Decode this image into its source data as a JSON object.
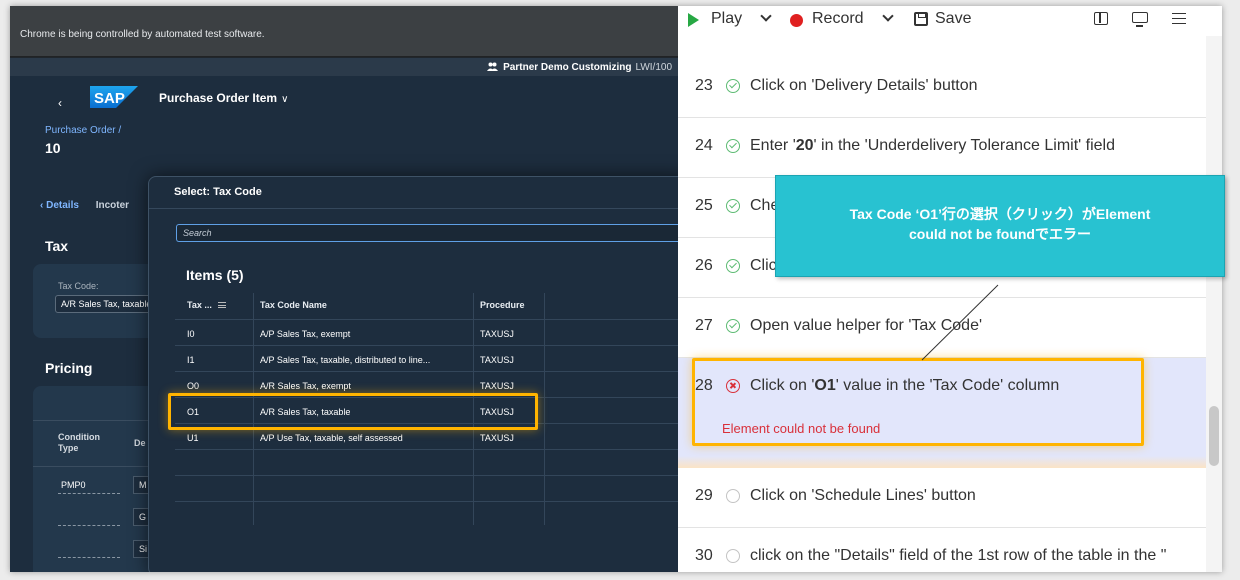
{
  "browser": {
    "automation_notice": "Chrome is being controlled by automated test software."
  },
  "sap": {
    "shellbar": {
      "customizing": "Partner Demo Customizing",
      "system": "LWI/100"
    },
    "app_title": "Purchase Order Item",
    "breadcrumb": "Purchase Order /",
    "object_number": "10",
    "tabs": {
      "details": "Details",
      "incoterms": "Incoter"
    },
    "tax_section": {
      "title": "Tax",
      "tax_code_label": "Tax Code:",
      "tax_code_value": "A/R Sales Tax, taxable"
    },
    "pricing_section": {
      "title": "Pricing",
      "col_condition_type": "Condition\nType",
      "col_desc": "De",
      "rows": [
        {
          "type": "PMP0",
          "desc": "M"
        },
        {
          "type": "",
          "desc": "G"
        },
        {
          "type": "",
          "desc": "Si"
        }
      ]
    }
  },
  "dialog": {
    "title": "Select: Tax Code",
    "search_placeholder": "Search",
    "items_title": "Items (5)",
    "columns": [
      "Tax ...",
      "Tax Code Name",
      "Procedure"
    ],
    "rows": [
      {
        "code": "I0",
        "name": "A/P Sales Tax, exempt",
        "procedure": "TAXUSJ"
      },
      {
        "code": "I1",
        "name": "A/P Sales Tax, taxable, distributed to line...",
        "procedure": "TAXUSJ"
      },
      {
        "code": "O0",
        "name": "A/R Sales Tax, exempt",
        "procedure": "TAXUSJ"
      },
      {
        "code": "O1",
        "name": "A/R Sales Tax, taxable",
        "procedure": "TAXUSJ"
      },
      {
        "code": "U1",
        "name": "A/P Use Tax, taxable, self assessed",
        "procedure": "TAXUSJ"
      }
    ]
  },
  "recorder": {
    "toolbar": {
      "play": "Play",
      "record": "Record",
      "save": "Save"
    },
    "steps": [
      {
        "num": "23",
        "status": "ok",
        "text_html": "Click on 'Delivery Details' button"
      },
      {
        "num": "24",
        "status": "ok",
        "text_html": "Enter '<b>20</b>' in the 'Underdelivery Tolerance Limit' field"
      },
      {
        "num": "25",
        "status": "ok",
        "text_html": "Che"
      },
      {
        "num": "26",
        "status": "ok",
        "text_html": "Clic"
      },
      {
        "num": "27",
        "status": "ok",
        "text_html": "Open value helper for 'Tax Code'"
      },
      {
        "num": "28",
        "status": "error",
        "text_html": "Click on '<b>O1</b>' value in the 'Tax Code' column",
        "error": "Element could not be found"
      },
      {
        "num": "29",
        "status": "pending",
        "text_html": "Click on 'Schedule Lines' button"
      },
      {
        "num": "30",
        "status": "pending",
        "text_html": "click on the \"Details\" field of the 1st row of the table in the \""
      }
    ]
  },
  "callout": {
    "line1": "Tax Code ‘O1’行の選択（クリック）がElement",
    "line2": "could not be foundでエラー"
  },
  "colors": {
    "highlight": "#ffb400",
    "callout": "#28c2d1",
    "sap_bg": "#1d2d3e",
    "error": "#d9303a",
    "success": "#5dbb73"
  }
}
